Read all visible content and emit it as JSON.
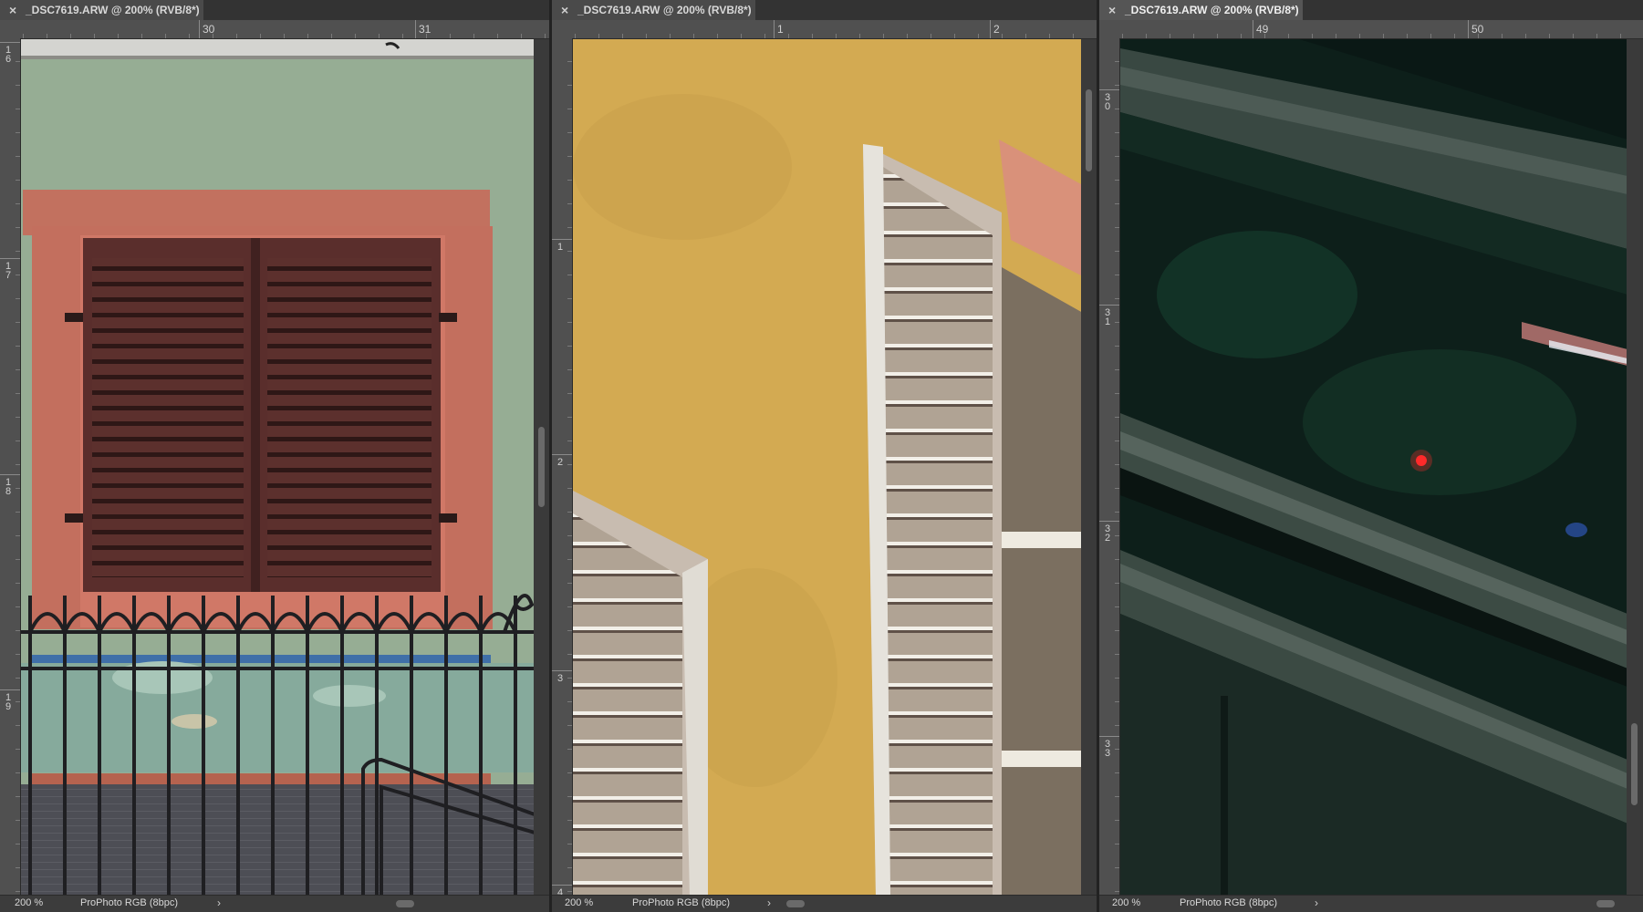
{
  "panels": [
    {
      "tab_title": "_DSC7619.ARW @ 200% (RVB/8*)",
      "active": false,
      "hruler_labels": [
        "30",
        "31"
      ],
      "vruler_labels": [
        "16",
        "17",
        "18",
        "19"
      ],
      "zoom": "200 %",
      "color_profile": "ProPhoto RGB (8bpc)"
    },
    {
      "tab_title": "_DSC7619.ARW @ 200% (RVB/8*)",
      "active": false,
      "hruler_labels": [
        "1",
        "2"
      ],
      "vruler_labels": [
        "1",
        "2",
        "3",
        "4"
      ],
      "zoom": "200 %",
      "color_profile": "ProPhoto RGB (8bpc)"
    },
    {
      "tab_title": "_DSC7619.ARW @ 200% (RVB/8*)",
      "active": true,
      "hruler_labels": [
        "49",
        "50"
      ],
      "vruler_labels": [
        "30",
        "31",
        "32",
        "33"
      ],
      "zoom": "200 %",
      "color_profile": "ProPhoto RGB (8bpc)"
    }
  ],
  "icons": {
    "close": "×",
    "chevron": "›"
  },
  "colors": {
    "wall_green": "#95ad93",
    "shutter_brown": "#5a2e2c",
    "frame_sandstone": "#c4715f",
    "wall_yellow": "#d4aa50",
    "shutter_white": "#b3a596",
    "night_window": "#0e1f1a"
  }
}
